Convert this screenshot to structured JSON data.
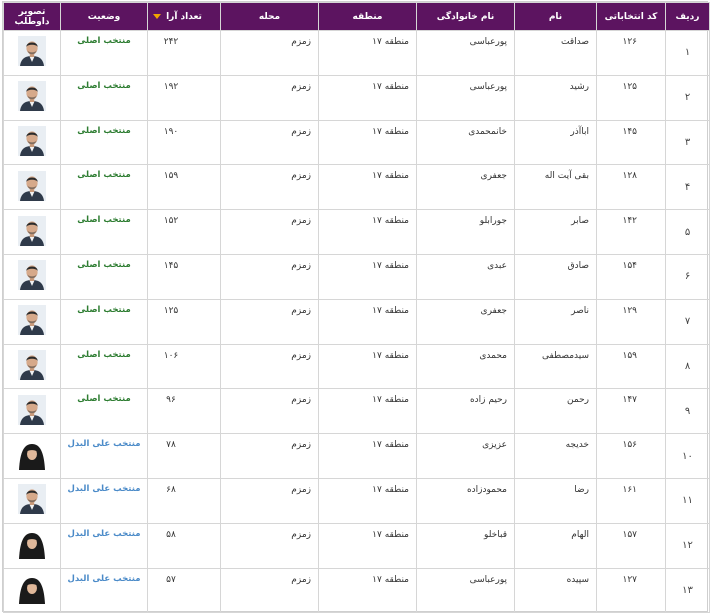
{
  "headers": {
    "index": "ردیف",
    "code": "کد انتخاباتی",
    "first_name": "نام",
    "last_name": "نام خانوادگی",
    "region": "منطقه",
    "area": "محله",
    "votes": "تعداد آرا",
    "status": "وضعیت",
    "photo": "تصویر داوطلب"
  },
  "rows": [
    {
      "index": "۱",
      "code": "۱۲۶",
      "first_name": "صداقت",
      "last_name": "پورعباسی",
      "region": "منطقه ۱۷",
      "area": "زمزم",
      "votes": "۲۴۲",
      "status": "منتخب اصلی",
      "status_type": "main",
      "avatar": "male"
    },
    {
      "index": "۲",
      "code": "۱۲۵",
      "first_name": "رشید",
      "last_name": "پورعباسی",
      "region": "منطقه ۱۷",
      "area": "زمزم",
      "votes": "۱۹۲",
      "status": "منتخب اصلی",
      "status_type": "main",
      "avatar": "male"
    },
    {
      "index": "۳",
      "code": "۱۴۵",
      "first_name": "اباآذر",
      "last_name": "خانمحمدی",
      "region": "منطقه ۱۷",
      "area": "زمزم",
      "votes": "۱۹۰",
      "status": "منتخب اصلی",
      "status_type": "main",
      "avatar": "male"
    },
    {
      "index": "۴",
      "code": "۱۲۸",
      "first_name": "بقی آیت اله",
      "last_name": "جعفری",
      "region": "منطقه ۱۷",
      "area": "زمزم",
      "votes": "۱۵۹",
      "status": "منتخب اصلی",
      "status_type": "main",
      "avatar": "male"
    },
    {
      "index": "۵",
      "code": "۱۴۲",
      "first_name": "صابر",
      "last_name": "جورابلو",
      "region": "منطقه ۱۷",
      "area": "زمزم",
      "votes": "۱۵۲",
      "status": "منتخب اصلی",
      "status_type": "main",
      "avatar": "male"
    },
    {
      "index": "۶",
      "code": "۱۵۴",
      "first_name": "صادق",
      "last_name": "عبدی",
      "region": "منطقه ۱۷",
      "area": "زمزم",
      "votes": "۱۴۵",
      "status": "منتخب اصلی",
      "status_type": "main",
      "avatar": "male"
    },
    {
      "index": "۷",
      "code": "۱۲۹",
      "first_name": "ناصر",
      "last_name": "جعفری",
      "region": "منطقه ۱۷",
      "area": "زمزم",
      "votes": "۱۲۵",
      "status": "منتخب اصلی",
      "status_type": "main",
      "avatar": "male"
    },
    {
      "index": "۸",
      "code": "۱۵۹",
      "first_name": "سیدمصطفی",
      "last_name": "محمدی",
      "region": "منطقه ۱۷",
      "area": "زمزم",
      "votes": "۱۰۶",
      "status": "منتخب اصلی",
      "status_type": "main",
      "avatar": "male"
    },
    {
      "index": "۹",
      "code": "۱۴۷",
      "first_name": "رحمن",
      "last_name": "رحیم زاده",
      "region": "منطقه ۱۷",
      "area": "زمزم",
      "votes": "۹۶",
      "status": "منتخب اصلی",
      "status_type": "main",
      "avatar": "male"
    },
    {
      "index": "۱۰",
      "code": "۱۵۶",
      "first_name": "خدیجه",
      "last_name": "عزیزی",
      "region": "منطقه ۱۷",
      "area": "زمزم",
      "votes": "۷۸",
      "status": "منتخب علی البدل",
      "status_type": "alt",
      "avatar": "female"
    },
    {
      "index": "۱۱",
      "code": "۱۶۱",
      "first_name": "رضا",
      "last_name": "محمودزاده",
      "region": "منطقه ۱۷",
      "area": "زمزم",
      "votes": "۶۸",
      "status": "منتخب علی البدل",
      "status_type": "alt",
      "avatar": "male"
    },
    {
      "index": "۱۲",
      "code": "۱۵۷",
      "first_name": "الهام",
      "last_name": "قباخلو",
      "region": "منطقه ۱۷",
      "area": "زمزم",
      "votes": "۵۸",
      "status": "منتخب علی البدل",
      "status_type": "alt",
      "avatar": "female"
    },
    {
      "index": "۱۳",
      "code": "۱۲۷",
      "first_name": "سپیده",
      "last_name": "پورعباسی",
      "region": "منطقه ۱۷",
      "area": "زمزم",
      "votes": "۵۷",
      "status": "منتخب علی البدل",
      "status_type": "alt",
      "avatar": "female"
    }
  ],
  "colors": {
    "header_bg": "#5c1460",
    "status_main": "#2e7d32",
    "status_alt": "#4a8ac8",
    "sort_arrow": "#f0a500"
  },
  "sort": {
    "column": "votes",
    "direction": "desc",
    "icon": "sort-desc-arrow-icon"
  }
}
